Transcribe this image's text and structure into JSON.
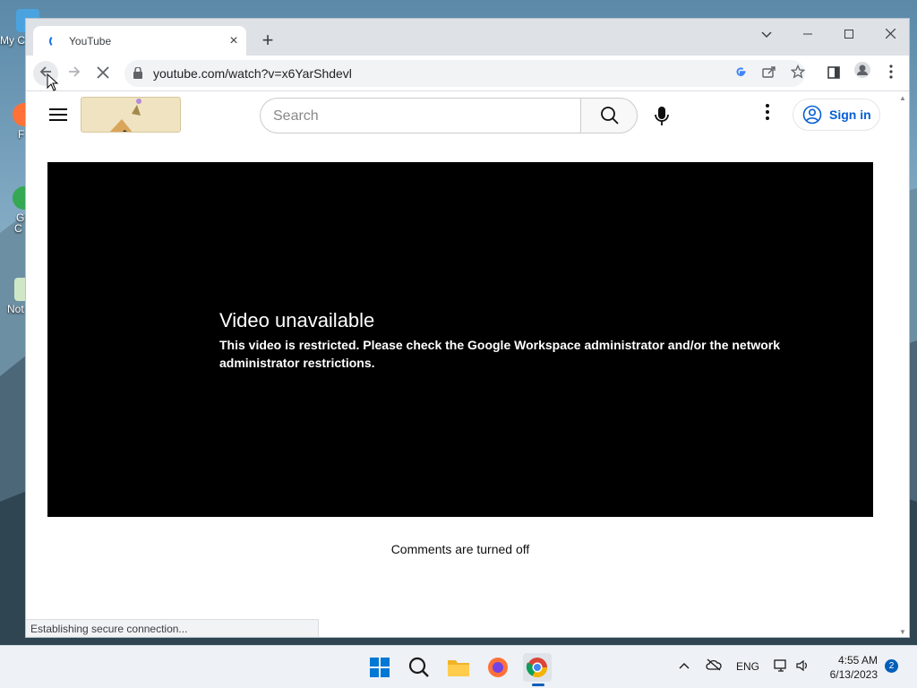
{
  "desktop": {
    "icons": [
      {
        "label": "My C"
      },
      {
        "label": "F"
      },
      {
        "label": "G"
      },
      {
        "label": "C"
      },
      {
        "label": "Not"
      }
    ]
  },
  "browser": {
    "tab": {
      "title": "YouTube",
      "close": "×"
    },
    "new_tab": "+",
    "window_controls": {
      "dropdown": "⌄",
      "minimize": "—",
      "maximize": "▢",
      "close": "✕"
    },
    "nav": {
      "back": "←",
      "forward": "→",
      "stop": "✕"
    },
    "url": "youtube.com/watch?v=x6YarShdevl",
    "status": "Establishing secure connection..."
  },
  "youtube": {
    "search_placeholder": "Search",
    "signin_label": "Sign in",
    "video_error_title": "Video unavailable",
    "video_error_message": "This video is restricted. Please check the Google Workspace administrator and/or the network administrator restrictions.",
    "comments_status": "Comments are turned off"
  },
  "taskbar": {
    "language": "ENG",
    "time": "4:55 AM",
    "date": "6/13/2023",
    "notification_count": "2"
  },
  "colors": {
    "yt_link_blue": "#065fd4",
    "tab_strip": "#dee1e6",
    "taskbar_accent": "#005fb8"
  }
}
